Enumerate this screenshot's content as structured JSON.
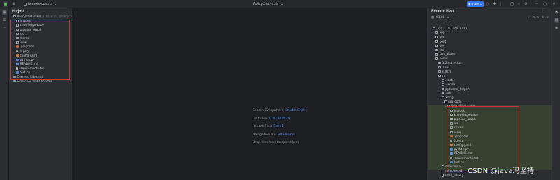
{
  "titlebar": {
    "remote_label": "Remote control",
    "project_name": "PolicyChat-main",
    "run_config": "main"
  },
  "left_stripe": {
    "icons": [
      "project-icon",
      "structure-icon",
      "more-icon"
    ]
  },
  "project_panel": {
    "title": "Project",
    "root": "PolicyChat-main",
    "root_path": "C:\\Users\\...\\PolicyChat-main",
    "items": [
      {
        "label": "images",
        "kind": "folder",
        "depth": 1,
        "arrow": "›"
      },
      {
        "label": "knowledge-base",
        "kind": "folder",
        "depth": 1,
        "arrow": "›"
      },
      {
        "label": "pipeline_graph",
        "kind": "folder",
        "depth": 1,
        "arrow": "›"
      },
      {
        "label": "src",
        "kind": "folder",
        "depth": 1,
        "arrow": "›"
      },
      {
        "label": "stores",
        "kind": "folder",
        "depth": 1,
        "arrow": "›"
      },
      {
        "label": "view",
        "kind": "folder",
        "depth": 1,
        "arrow": "›"
      },
      {
        "label": ".gitignore",
        "kind": "git",
        "depth": 1,
        "arrow": ""
      },
      {
        "label": "0l.png",
        "kind": "file",
        "depth": 1,
        "arrow": ""
      },
      {
        "label": "config.yaml",
        "kind": "yaml",
        "depth": 1,
        "arrow": ""
      },
      {
        "label": "python.py",
        "kind": "py",
        "depth": 1,
        "arrow": ""
      },
      {
        "label": "README.md",
        "kind": "md",
        "depth": 1,
        "arrow": ""
      },
      {
        "label": "requirements.txt",
        "kind": "txt",
        "depth": 1,
        "arrow": ""
      },
      {
        "label": "test.py",
        "kind": "py",
        "depth": 1,
        "arrow": ""
      }
    ],
    "external_libraries": "External Libraries",
    "scratches": "Scratches and Consoles"
  },
  "editor_hints": [
    {
      "label": "Search Everywhere",
      "key": "Double Shift"
    },
    {
      "label": "Go to File",
      "key": "Ctrl+Shift+N"
    },
    {
      "label": "Recent Files",
      "key": "Ctrl+E"
    },
    {
      "label": "Navigation Bar",
      "key": "Alt+Home"
    },
    {
      "label": "Drop files here to open them",
      "key": ""
    }
  ],
  "remote_panel": {
    "title": "Remote Host",
    "connection": "fl1.88",
    "root": "/ (ro... 192.168.1.88)",
    "items": [
      {
        "label": "app",
        "kind": "folder",
        "depth": 1,
        "arrow": "›"
      },
      {
        "label": "bin",
        "kind": "folder",
        "depth": 1,
        "arrow": "›"
      },
      {
        "label": "boot",
        "kind": "folder",
        "depth": 1,
        "arrow": "›"
      },
      {
        "label": "dev",
        "kind": "folder",
        "depth": 1,
        "arrow": "›"
      },
      {
        "label": "etc",
        "kind": "folder",
        "depth": 1,
        "arrow": "›"
      },
      {
        "label": "fork_cluster",
        "kind": "folder",
        "depth": 1,
        "arrow": "›"
      },
      {
        "label": "home",
        "kind": "folder",
        "depth": 1,
        "arrow": "⌄"
      },
      {
        "label": "1.2.0.1.m.l.c",
        "kind": "folder",
        "depth": 2,
        "arrow": ""
      },
      {
        "label": "1.ros",
        "kind": "folder",
        "depth": 2,
        "arrow": "›"
      },
      {
        "label": "n.ltr.n",
        "kind": "folder",
        "depth": 2,
        "arrow": "›"
      },
      {
        "label": "rp",
        "kind": "folder",
        "depth": 2,
        "arrow": "⌄"
      },
      {
        "label": ".cache",
        "kind": "folder",
        "depth": 3,
        "arrow": "›"
      },
      {
        "label": ".conda",
        "kind": "folder",
        "depth": 3,
        "arrow": "›"
      },
      {
        "label": "pycharm_helpers",
        "kind": "folder",
        "depth": 3,
        "arrow": "›"
      },
      {
        "label": ".ssh",
        "kind": "folder",
        "depth": 3,
        "arrow": "›"
      },
      {
        "label": "xiang",
        "kind": "folder",
        "depth": 3,
        "arrow": "⌄"
      },
      {
        "label": "rag_code",
        "kind": "folder",
        "depth": 4,
        "arrow": "⌄"
      },
      {
        "label": "PolicyChat-main",
        "kind": "folder",
        "depth": 5,
        "arrow": "⌄"
      },
      {
        "label": "images",
        "kind": "folder",
        "depth": 6,
        "arrow": "›"
      },
      {
        "label": "knowledge-base",
        "kind": "folder",
        "depth": 6,
        "arrow": "›"
      },
      {
        "label": "pipeline_graph",
        "kind": "folder",
        "depth": 6,
        "arrow": "›"
      },
      {
        "label": "src",
        "kind": "folder",
        "depth": 6,
        "arrow": "›"
      },
      {
        "label": "stores",
        "kind": "folder",
        "depth": 6,
        "arrow": "›"
      },
      {
        "label": "view",
        "kind": "folder",
        "depth": 6,
        "arrow": "›"
      },
      {
        "label": ".gitignore",
        "kind": "git",
        "depth": 6,
        "arrow": ""
      },
      {
        "label": "0l.png",
        "kind": "file",
        "depth": 6,
        "arrow": ""
      },
      {
        "label": "config.yaml",
        "kind": "yaml",
        "depth": 6,
        "arrow": ""
      },
      {
        "label": "python.py",
        "kind": "py",
        "depth": 6,
        "arrow": ""
      },
      {
        "label": "README.md",
        "kind": "md",
        "depth": 6,
        "arrow": ""
      },
      {
        "label": "requirements.txt",
        "kind": "txt",
        "depth": 6,
        "arrow": ""
      },
      {
        "label": "test.py",
        "kind": "py",
        "depth": 6,
        "arrow": ""
      },
      {
        "label": "miniconda",
        "kind": "folder",
        "depth": 3,
        "arrow": "›"
      },
      {
        "label": "miniconda3",
        "kind": "folder",
        "depth": 3,
        "arrow": "›"
      },
      {
        "label": "swell_history",
        "kind": "file",
        "depth": 3,
        "arrow": ""
      }
    ]
  },
  "right_stripe": {
    "icons": [
      "remote-host-icon",
      "database-icon",
      "notifications-icon"
    ]
  },
  "watermark": "CSDN @java冯坚持",
  "colors": {
    "accent": "#3574f0",
    "highlight_box": "#c8312f",
    "shortcut_key": "#548af7"
  }
}
